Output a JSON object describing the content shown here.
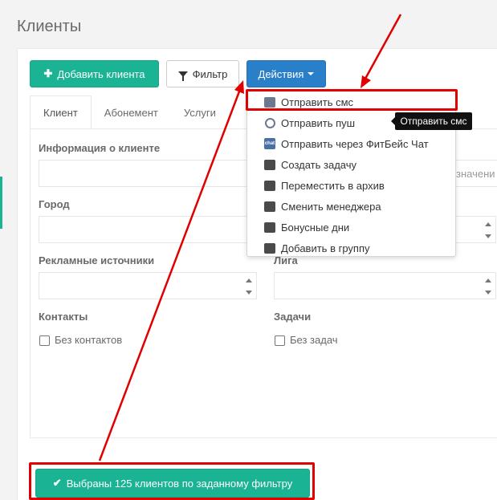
{
  "page": {
    "title": "Клиенты"
  },
  "toolbar": {
    "add_client_label": "Добавить клиента",
    "filter_label": "Фильтр",
    "actions_label": "Действия"
  },
  "tabs": [
    {
      "label": "Клиент",
      "active": true
    },
    {
      "label": "Абонемент",
      "active": false
    },
    {
      "label": "Услуги",
      "active": false
    }
  ],
  "form": {
    "client_info_label": "Информация о клиенте",
    "city_label": "Город",
    "ad_sources_label": "Рекламные источники",
    "league_label": "Лига",
    "contacts_label": "Контакты",
    "tasks_label": "Задачи",
    "no_contacts_label": "Без контактов",
    "no_tasks_label": "Без задач",
    "partial_placeholder": "значени"
  },
  "actions_menu": {
    "items": [
      {
        "label": "Отправить смс",
        "icon": "sms-icon"
      },
      {
        "label": "Отправить пуш",
        "icon": "push-icon"
      },
      {
        "label": "Отправить через ФитБейс Чат",
        "icon": "chat-icon",
        "icon_text": "chat"
      },
      {
        "label": "Создать задачу",
        "icon": "task-icon"
      },
      {
        "label": "Переместить в архив",
        "icon": "archive-icon"
      },
      {
        "label": "Сменить менеджера",
        "icon": "manager-icon"
      },
      {
        "label": "Бонусные дни",
        "icon": "calendar-icon"
      },
      {
        "label": "Добавить в группу",
        "icon": "folder-add-icon"
      }
    ]
  },
  "tooltip": {
    "text": "Отправить смс"
  },
  "selection_banner": {
    "label": "Выбраны 125 клиентов по заданному фильтру"
  },
  "colors": {
    "primary": "#1ab394",
    "actions": "#2a7fc9",
    "highlight": "#e00000"
  }
}
